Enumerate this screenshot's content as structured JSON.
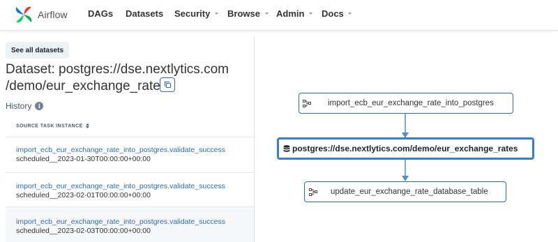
{
  "navbar": {
    "brand": "Airflow",
    "items": [
      {
        "label": "DAGs",
        "dropdown": false
      },
      {
        "label": "Datasets",
        "dropdown": false
      },
      {
        "label": "Security",
        "dropdown": true
      },
      {
        "label": "Browse",
        "dropdown": true
      },
      {
        "label": "Admin",
        "dropdown": true
      },
      {
        "label": "Docs",
        "dropdown": true
      }
    ]
  },
  "left": {
    "see_all_label": "See all datasets",
    "title_line1": "Dataset: postgres://dse.nextlytics.com",
    "title_line2": "/demo/eur_exchange_rates",
    "history_label": "History",
    "column_header": "SOURCE TASK INSTANCE",
    "events": [
      {
        "task": "import_ecb_eur_exchange_rate_into_postgres.validate_success",
        "run": "scheduled__2023-01-30T00:00:00+00:00"
      },
      {
        "task": "import_ecb_eur_exchange_rate_into_postgres.validate_success",
        "run": "scheduled__2023-02-01T00:00:00+00:00"
      },
      {
        "task": "import_ecb_eur_exchange_rate_into_postgres.validate_success",
        "run": "scheduled__2023-02-03T00:00:00+00:00"
      }
    ]
  },
  "graph": {
    "producer": "import_ecb_eur_exchange_rate_into_postgres",
    "dataset": "postgres://dse.nextlytics.com/demo/eur_exchange_rates",
    "consumer": "update_eur_exchange_rate_database_table"
  },
  "colors": {
    "accent": "#2b6cb0",
    "dataset_border": "#3182ce",
    "edge": "#4a90c9",
    "link": "#2b6cb0"
  }
}
